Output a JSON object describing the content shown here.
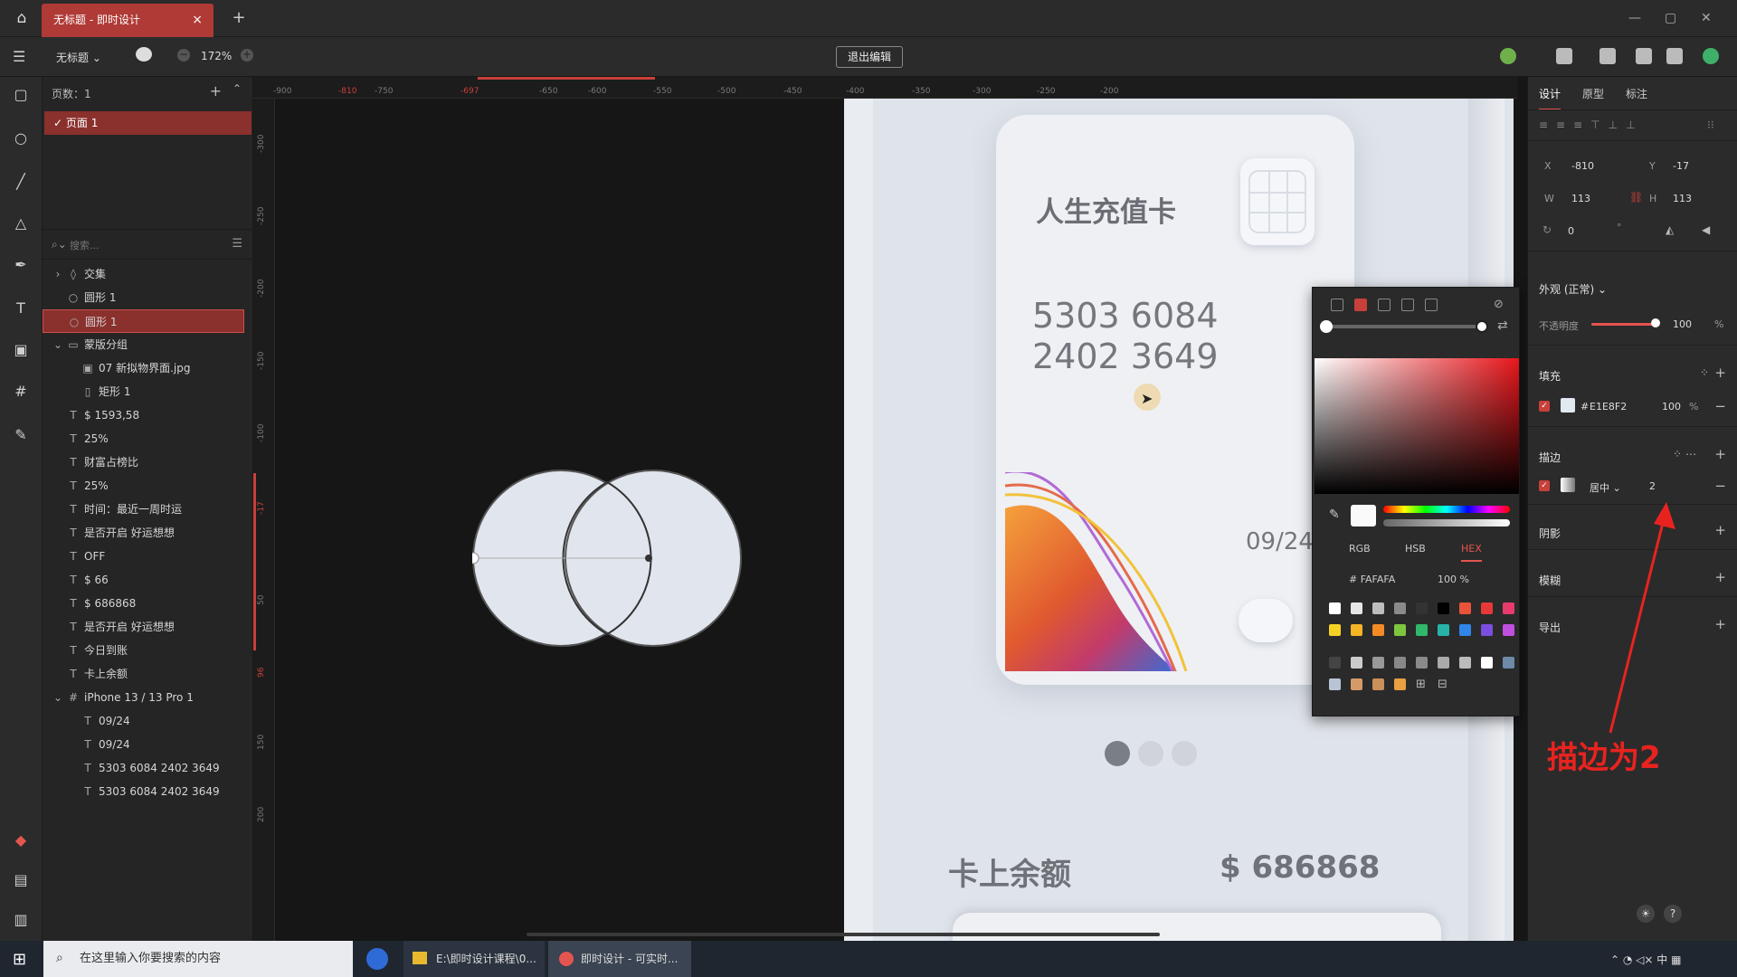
{
  "tabs": {
    "doc_tab": "无标题 - 即时设计",
    "close": "×",
    "new": "+"
  },
  "toolbar": {
    "file_name": "无标题",
    "zoom": "172%",
    "zoom_minus": "−",
    "zoom_plus": "+",
    "exit_edit": "退出编辑"
  },
  "pages": {
    "header": "页数：1",
    "items": [
      "页面 1"
    ]
  },
  "layers": {
    "search_placeholder": "搜索...",
    "items": [
      {
        "icon": "◊",
        "label": "交集",
        "indent": 1,
        "expander": "›"
      },
      {
        "icon": "○",
        "label": "圆形 1",
        "indent": 1
      },
      {
        "icon": "○",
        "label": "圆形 1",
        "indent": 1,
        "selected": true
      },
      {
        "icon": "▭",
        "label": "蒙版分组",
        "indent": 1,
        "expander": "⌄"
      },
      {
        "icon": "▣",
        "label": "07 新拟物界面.jpg",
        "indent": 2
      },
      {
        "icon": "▯",
        "label": "矩形 1",
        "indent": 2
      },
      {
        "icon": "T",
        "label": "$ 1593,58",
        "indent": 1
      },
      {
        "icon": "T",
        "label": "25%",
        "indent": 1
      },
      {
        "icon": "T",
        "label": "财富占榜比",
        "indent": 1
      },
      {
        "icon": "T",
        "label": "25%",
        "indent": 1
      },
      {
        "icon": "T",
        "label": "时间：最近一周时运",
        "indent": 1
      },
      {
        "icon": "T",
        "label": "是否开启 好运想想",
        "indent": 1
      },
      {
        "icon": "T",
        "label": "OFF",
        "indent": 1
      },
      {
        "icon": "T",
        "label": "$ 66",
        "indent": 1
      },
      {
        "icon": "T",
        "label": "$ 686868",
        "indent": 1
      },
      {
        "icon": "T",
        "label": "是否开启 好运想想",
        "indent": 1
      },
      {
        "icon": "T",
        "label": "今日到账",
        "indent": 1
      },
      {
        "icon": "T",
        "label": "卡上余额",
        "indent": 1
      },
      {
        "icon": "#",
        "label": "iPhone 13 / 13 Pro 1",
        "indent": 1,
        "expander": "⌄"
      },
      {
        "icon": "T",
        "label": "09/24",
        "indent": 2
      },
      {
        "icon": "T",
        "label": "09/24",
        "indent": 2
      },
      {
        "icon": "T",
        "label": "5303 6084 2402 3649",
        "indent": 2
      },
      {
        "icon": "T",
        "label": "5303 6084 2402 3649",
        "indent": 2
      }
    ]
  },
  "ruler": {
    "top": [
      "-900",
      "-810",
      "-750",
      "-697",
      "-650",
      "-600",
      "-550",
      "-500",
      "-450",
      "-400",
      "-350",
      "-300",
      "-250",
      "-200"
    ],
    "left": [
      "-300",
      "-250",
      "-200",
      "-150",
      "-100",
      "-17",
      "50",
      "96",
      "150",
      "200"
    ]
  },
  "card": {
    "title": "人生充值卡",
    "number_line1": "5303 6084",
    "number_line2": "2402 3649",
    "expiry": "09/24",
    "balance_label": "卡上余额",
    "balance_value": "$ 686868"
  },
  "picker": {
    "tabs": [
      "RGB",
      "HSB",
      "HEX"
    ],
    "active_tab": "HEX",
    "hex": "FAFAFA",
    "opacity": "100",
    "opacity_unit": "%",
    "swatches_row1": [
      "#ffffff",
      "#e6e6e6",
      "#bdbdbd",
      "#8a8a8a",
      "#333333",
      "#000000",
      "#e8533a",
      "#e83838",
      "#e83a6b"
    ],
    "swatches_row2": [
      "#f5d325",
      "#f5b325",
      "#f58b25",
      "#7fc63f",
      "#2fb86a",
      "#27b3a8",
      "#2f86e8",
      "#7a4fe0",
      "#c04fe0"
    ],
    "swatches_row3": [
      "#444444",
      "#cccccc",
      "#999999",
      "#888888",
      "#8a8a8a",
      "#aaaaaa",
      "#bbbbbb",
      "#ffffff",
      "#6d8aa8"
    ],
    "swatches_row4": [
      "#b8c4d4",
      "#d49a6a",
      "#c9905a",
      "#e8a040"
    ]
  },
  "props": {
    "tabs": [
      "设计",
      "原型",
      "标注"
    ],
    "x_label": "X",
    "x": "-810",
    "y_label": "Y",
    "y": "-17",
    "w_label": "W",
    "w": "113",
    "h_label": "H",
    "h": "113",
    "rotation": "0",
    "rotation_unit": "°",
    "appearance": "外观 (正常)",
    "opacity_label": "不透明度",
    "opacity": "100",
    "opacity_unit": "%",
    "fill_title": "填充",
    "fill_hex_prefix": "#",
    "fill_hex": "E1E8F2",
    "fill_opacity": "100",
    "fill_opacity_unit": "%",
    "stroke_title": "描边",
    "stroke_position": "居中",
    "stroke_width": "2",
    "shadow_title": "阴影",
    "blur_title": "模糊",
    "export_title": "导出",
    "annotation": "描边为2"
  },
  "taskbar": {
    "search": "在这里输入你要搜索的内容",
    "app1": "E:\\即时设计课程\\0...",
    "app2": "即时设计 - 可实时...",
    "ime": "中"
  },
  "colors": {
    "accent": "#e4554f",
    "selected_bg": "#8a302d",
    "fill": "#E1E8F2"
  }
}
